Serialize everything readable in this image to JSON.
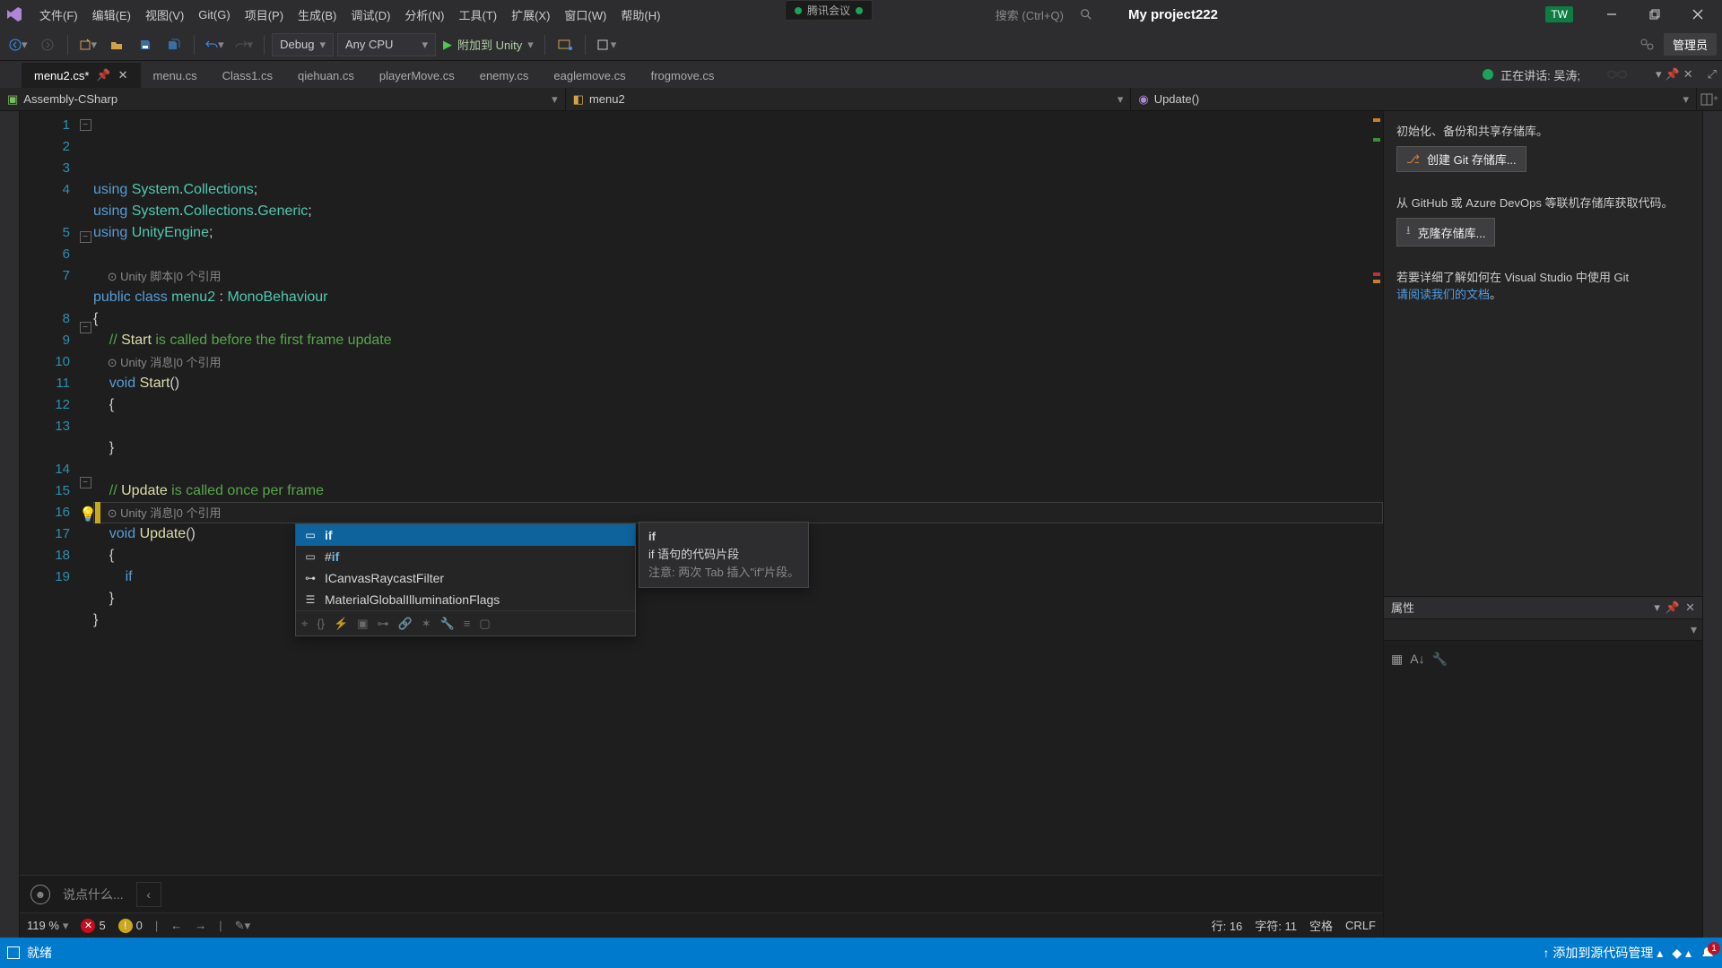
{
  "menu": {
    "items": [
      "文件(F)",
      "编辑(E)",
      "视图(V)",
      "Git(G)",
      "项目(P)",
      "生成(B)",
      "调试(D)",
      "分析(N)",
      "工具(T)",
      "扩展(X)",
      "窗口(W)",
      "帮助(H)"
    ],
    "search_placeholder": "搜索 (Ctrl+Q)",
    "project_title": "My project222",
    "user_badge": "TW",
    "tencent": "腾讯会议"
  },
  "toolbar": {
    "config": "Debug",
    "platform": "Any CPU",
    "run_label": "附加到 Unity",
    "admin": "管理员"
  },
  "tabs": {
    "items": [
      {
        "label": "menu2.cs*",
        "active": true,
        "dirty": true
      },
      {
        "label": "menu.cs"
      },
      {
        "label": "Class1.cs"
      },
      {
        "label": "qiehuan.cs"
      },
      {
        "label": "playerMove.cs"
      },
      {
        "label": "enemy.cs"
      },
      {
        "label": "eaglemove.cs"
      },
      {
        "label": "frogmove.cs"
      }
    ],
    "speaking_prefix": "正在讲话:",
    "speaking_name": "吴涛;"
  },
  "nav": {
    "assembly_icon": "csharp-project-icon",
    "assembly": "Assembly-CSharp",
    "class": "menu2",
    "method": "Update()"
  },
  "code": {
    "lines": [
      {
        "n": 1,
        "t": "using System.Collections;"
      },
      {
        "n": 2,
        "t": "using System.Collections.Generic;"
      },
      {
        "n": 3,
        "t": "using UnityEngine;"
      },
      {
        "n": 4,
        "t": ""
      },
      {
        "n": "",
        "lens": "Unity 脚本|0 个引用"
      },
      {
        "n": 5,
        "t": "public class menu2 : MonoBehaviour"
      },
      {
        "n": 6,
        "t": "{"
      },
      {
        "n": 7,
        "t": "    // Start is called before the first frame update"
      },
      {
        "n": "",
        "lens": "Unity 消息|0 个引用"
      },
      {
        "n": 8,
        "t": "    void Start()"
      },
      {
        "n": 9,
        "t": "    {"
      },
      {
        "n": 10,
        "t": "        "
      },
      {
        "n": 11,
        "t": "    }"
      },
      {
        "n": 12,
        "t": ""
      },
      {
        "n": 13,
        "t": "    // Update is called once per frame"
      },
      {
        "n": "",
        "lens": "Unity 消息|0 个引用"
      },
      {
        "n": 14,
        "t": "    void Update()"
      },
      {
        "n": 15,
        "t": "    {"
      },
      {
        "n": 16,
        "t": "        if"
      },
      {
        "n": 17,
        "t": "    }"
      },
      {
        "n": 18,
        "t": "}"
      },
      {
        "n": 19,
        "t": ""
      }
    ]
  },
  "intellisense": {
    "items": [
      {
        "label": "if",
        "kind": "snippet"
      },
      {
        "label": "#if",
        "kind": "snippet"
      },
      {
        "label": "ICanvasRaycastFilter",
        "kind": "interface"
      },
      {
        "label": "MaterialGlobalIlluminationFlags",
        "kind": "enum"
      }
    ],
    "tooltip_title": "if",
    "tooltip_line1": "if 语句的代码片段",
    "tooltip_line2": "注意: 两次 Tab 插入\"if\"片段。"
  },
  "side": {
    "git_intro": "初始化、备份和共享存储库。",
    "git_create": "创建 Git 存储库...",
    "git_clone_intro": "从 GitHub 或 Azure DevOps 等联机存储库获取代码。",
    "git_clone": "克隆存储库...",
    "git_more": "若要详细了解如何在 Visual Studio 中使用 Git",
    "git_link": "请阅读我们的文档",
    "git_more_end": "。",
    "prop_title": "属性"
  },
  "foot": {
    "zoom": "119 %",
    "err": "5",
    "warn": "0",
    "line_label": "行:",
    "line": "16",
    "col_label": "字符:",
    "col": "11",
    "spaces": "空格",
    "eol": "CRLF"
  },
  "voice": {
    "placeholder": "说点什么..."
  },
  "status": {
    "ready": "就绪",
    "source": "添加到源代码管理",
    "bell": "1"
  }
}
